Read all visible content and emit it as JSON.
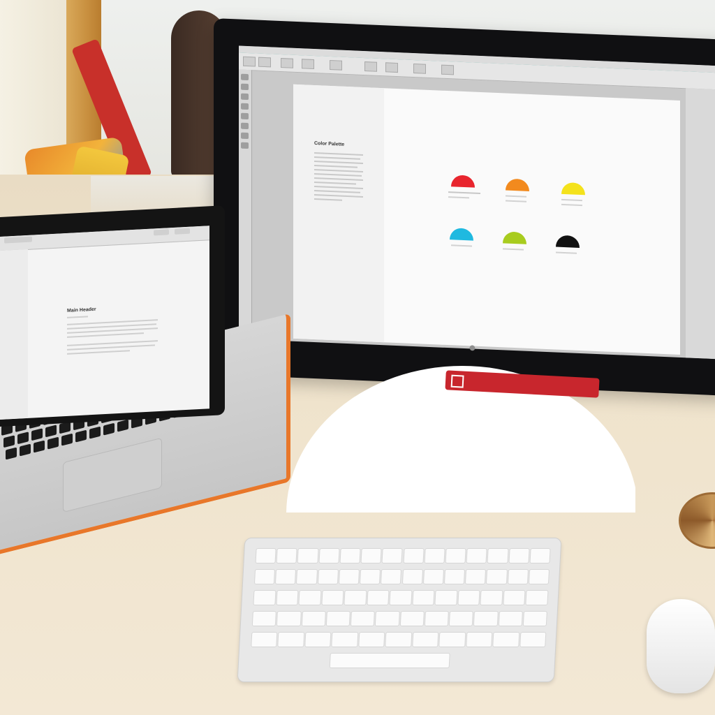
{
  "monitor": {
    "doc_title": "Color Palette",
    "swatch_colors": [
      "#e8252e",
      "#f28a1e",
      "#f4e21c",
      "#1fb9e0",
      "#a8cc1f",
      "#111111"
    ]
  },
  "laptop": {
    "doc_header": "Main Header"
  },
  "fan": {
    "colors": [
      "#f4e21c",
      "#f7b32b",
      "#ee6a2a",
      "#e23a4a",
      "#d8408f",
      "#8a52b0",
      "#3b7dd0",
      "#2bb6c8",
      "#44b86a",
      "#a8cc1f",
      "#b8b8b8",
      "#8a6a5a"
    ]
  }
}
